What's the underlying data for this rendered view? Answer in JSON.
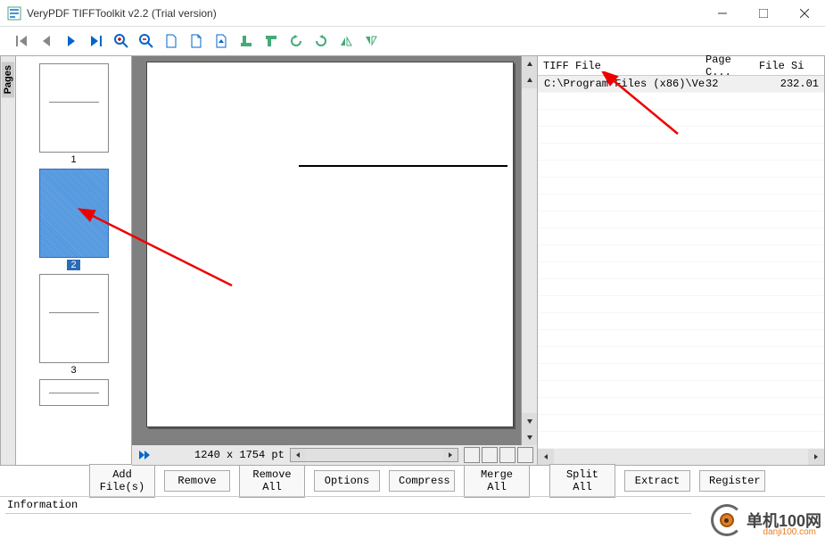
{
  "window": {
    "title": "VeryPDF TIFFToolkit v2.2 (Trial version)"
  },
  "pages_tab": "Pages",
  "thumbnails": [
    {
      "label": "1",
      "selected": false
    },
    {
      "label": "2",
      "selected": true
    },
    {
      "label": "3",
      "selected": false
    }
  ],
  "preview": {
    "dimensions": "1240 x 1754 pt"
  },
  "file_list": {
    "headers": {
      "file": "TIFF File",
      "pages": "Page C...",
      "size": "File Si"
    },
    "rows": [
      {
        "path": "C:\\Program Files (x86)\\Ver...",
        "pages": "32",
        "size": "232.01"
      }
    ]
  },
  "buttons": {
    "add": "Add File(s)",
    "remove": "Remove",
    "remove_all": "Remove All",
    "options": "Options",
    "compress": "Compress",
    "merge": "Merge All",
    "split": "Split All",
    "extract": "Extract",
    "register": "Register"
  },
  "status": "Information",
  "watermark": {
    "text": "单机100网",
    "url": "danji100.com"
  }
}
